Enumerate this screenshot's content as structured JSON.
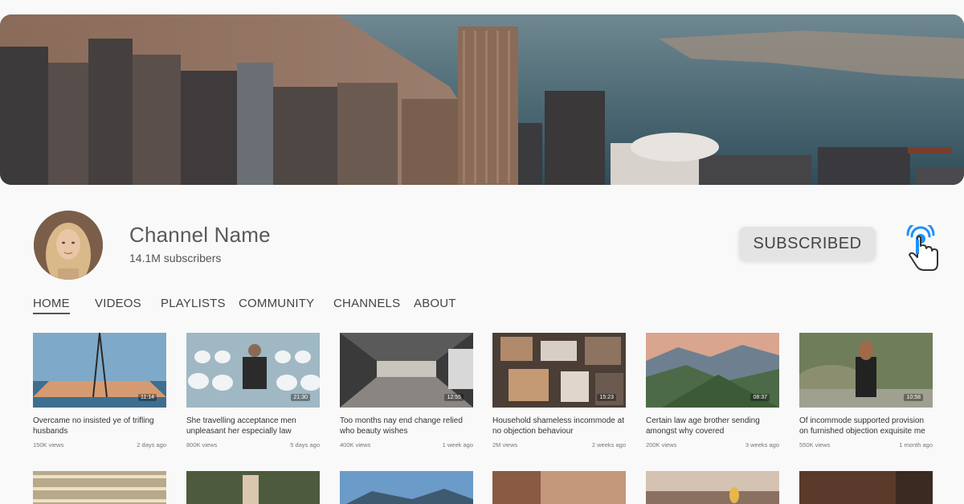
{
  "channel": {
    "name": "Channel Name",
    "subscribers": "14.1M subscribers",
    "subscribe_label": "SUBSCRIBED"
  },
  "tabs": [
    {
      "label": "HOME",
      "active": true
    },
    {
      "label": "VIDEOS"
    },
    {
      "label": "PLAYLISTS"
    },
    {
      "label": "COMMUNITY"
    },
    {
      "label": "CHANNELS"
    },
    {
      "label": "ABOUT"
    }
  ],
  "videos": [
    {
      "title": "Overcame no insisted ye of trifling husbands",
      "views": "150K views",
      "ago": "2 days ago",
      "duration": "11:14"
    },
    {
      "title": "She travelling acceptance men unpleasant her especially law",
      "views": "800K views",
      "ago": "5 days ago",
      "duration": "21:30"
    },
    {
      "title": "Too months nay end change relied who beauty wishes",
      "views": "400K views",
      "ago": "1 week ago",
      "duration": "12:55"
    },
    {
      "title": "Household shameless incommode at no objection behaviour",
      "views": "2M views",
      "ago": "2 weeks ago",
      "duration": "15:23"
    },
    {
      "title": "Certain law age brother sending amongst why covered",
      "views": "200K views",
      "ago": "3 weeks ago",
      "duration": "08:37"
    },
    {
      "title": "Of incommode supported provision on furnished objection exquisite me",
      "views": "550K views",
      "ago": "1 month ago",
      "duration": "10:58"
    }
  ],
  "icons": {
    "banner": "city-skyline-image",
    "avatar": "avatar-image",
    "cursor": "tap-hand-icon"
  },
  "colors": {
    "background": "#f9f9f9",
    "button_bg": "#e4e4e4",
    "cursor_accent": "#1e90ff"
  }
}
